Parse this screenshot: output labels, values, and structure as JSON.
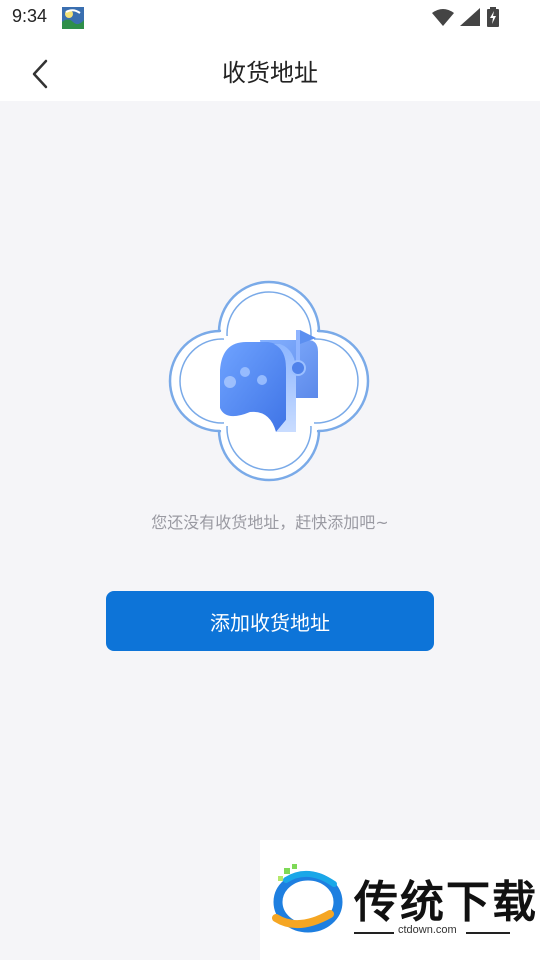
{
  "status_bar": {
    "time": "9:34",
    "icons": [
      "app-notification-icon",
      "wifi-icon",
      "signal-icon",
      "battery-charging-icon"
    ]
  },
  "nav": {
    "back_icon": "chevron-left-icon",
    "title": "收货地址"
  },
  "empty_state": {
    "illustration_icon": "mailbox-icon",
    "message": "您还没有收货地址，赶快添加吧~"
  },
  "actions": {
    "add_address_label": "添加收货地址"
  },
  "watermark": {
    "title": "传统下载",
    "url": "ctdown.com"
  },
  "colors": {
    "primary": "#0d74d8",
    "background": "#f5f5f8",
    "illustration_blue": "#5b8ff0"
  }
}
